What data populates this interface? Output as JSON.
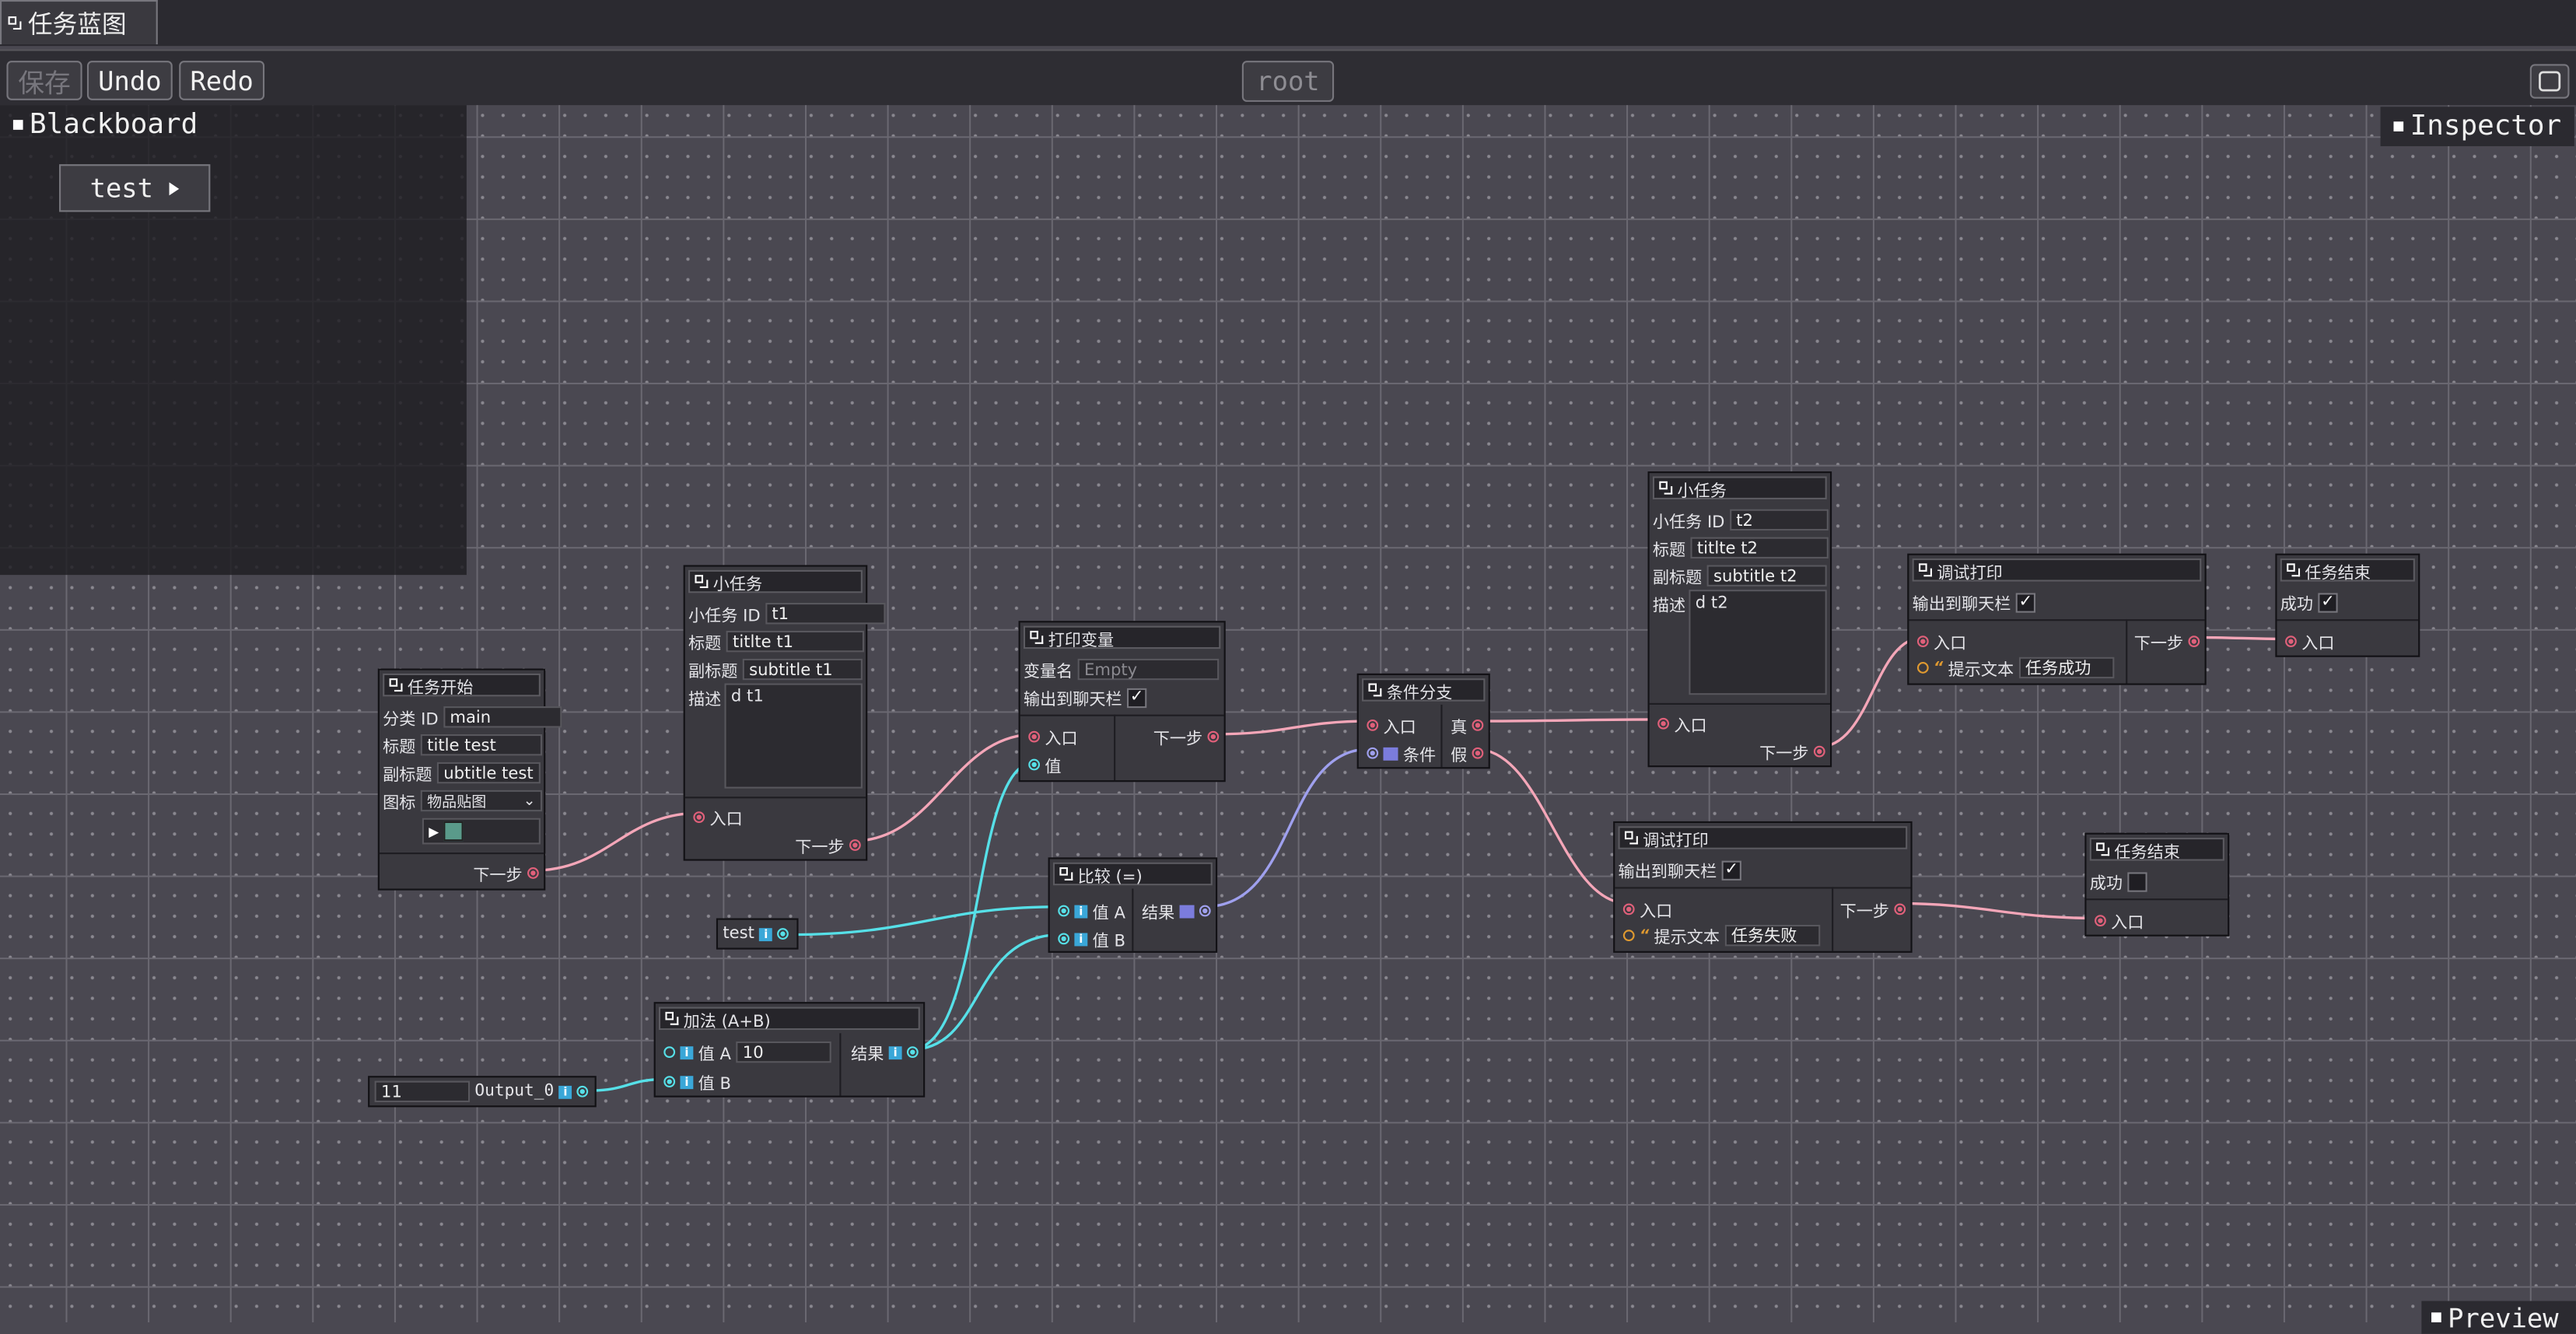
{
  "window": {
    "tab_title": "任务蓝图"
  },
  "toolbar": {
    "save": "保存",
    "undo": "Undo",
    "redo": "Redo",
    "root": "root"
  },
  "blackboard": {
    "title": "Blackboard",
    "variables": [
      "test"
    ]
  },
  "panels": {
    "inspector": "Inspector",
    "preview": "Preview"
  },
  "nodes": {
    "task_start": {
      "title": "任务开始",
      "category_label": "分类 ID",
      "category_value": "main",
      "title_label": "标题",
      "title_value": "title test",
      "subtitle_label": "副标题",
      "subtitle_value": "ubtitle test",
      "icon_label": "图标",
      "icon_value": "物品贴图",
      "next": "下一步"
    },
    "subtask1": {
      "title": "小任务",
      "id_label": "小任务 ID",
      "id_value": "t1",
      "title_label": "标题",
      "title_value": "titlte t1",
      "subtitle_label": "副标题",
      "subtitle_value": "subtitle t1",
      "desc_label": "描述",
      "desc_value": "d t1",
      "entry": "入口",
      "next": "下一步"
    },
    "print_var": {
      "title": "打印变量",
      "varname_label": "变量名",
      "varname_placeholder": "Empty",
      "output_label": "输出到聊天栏",
      "output_checked": "✓",
      "entry": "入口",
      "value": "值",
      "next": "下一步"
    },
    "branch": {
      "title": "条件分支",
      "entry": "入口",
      "condition": "条件",
      "true": "真",
      "false": "假"
    },
    "compare": {
      "title": "比较 (=)",
      "a": "值 A",
      "b": "值 B",
      "result": "结果"
    },
    "add": {
      "title": "加法 (A+B)",
      "a": "值 A",
      "a_value": "10",
      "b": "值 B",
      "result": "结果"
    },
    "test_var": {
      "label": "test"
    },
    "const_out": {
      "value": "11",
      "label": "Output_0"
    },
    "subtask2": {
      "title": "小任务",
      "id_label": "小任务 ID",
      "id_value": "t2",
      "title_label": "标题",
      "title_value": "titlte t2",
      "subtitle_label": "副标题",
      "subtitle_value": "subtitle t2",
      "desc_label": "描述",
      "desc_value": "d t2",
      "entry": "入口",
      "next": "下一步"
    },
    "debug1": {
      "title": "调试打印",
      "output_label": "输出到聊天栏",
      "output_checked": "✓",
      "entry": "入口",
      "hint_label": "提示文本",
      "hint_value": "任务成功",
      "next": "下一步"
    },
    "debug2": {
      "title": "调试打印",
      "output_label": "输出到聊天栏",
      "output_checked": "✓",
      "entry": "入口",
      "hint_label": "提示文本",
      "hint_value": "任务失败",
      "next": "下一步"
    },
    "end1": {
      "title": "任务结束",
      "success_label": "成功",
      "success_checked": "✓",
      "entry": "入口"
    },
    "end2": {
      "title": "任务结束",
      "success_label": "成功",
      "success_checked": "",
      "entry": "入口"
    }
  },
  "colors": {
    "exec_wire": "#f4a6b8",
    "data_wire": "#56e0e8",
    "bool_wire": "#9fa0ee"
  }
}
